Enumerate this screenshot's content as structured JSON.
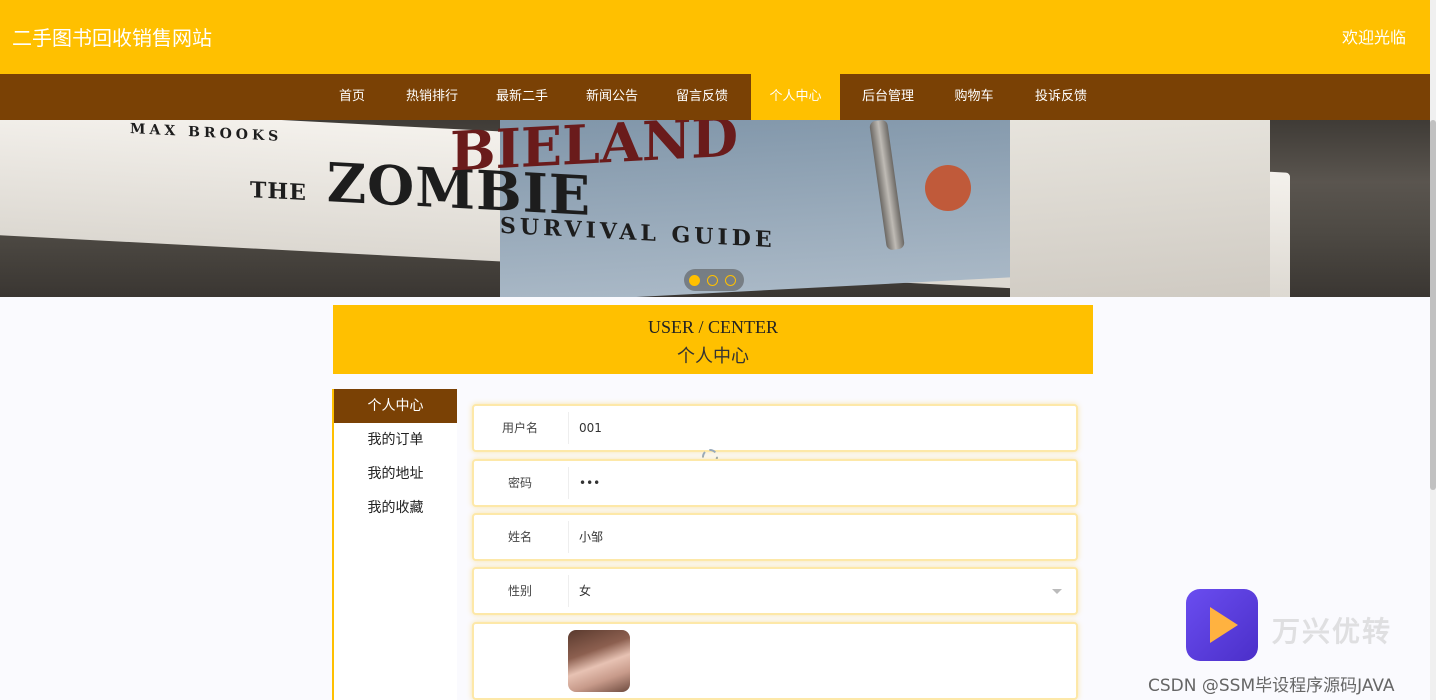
{
  "header": {
    "site_title": "二手图书回收销售网站",
    "welcome": "欢迎光临"
  },
  "nav": {
    "items": [
      {
        "label": "首页"
      },
      {
        "label": "热销排行"
      },
      {
        "label": "最新二手"
      },
      {
        "label": "新闻公告"
      },
      {
        "label": "留言反馈"
      },
      {
        "label": "个人中心",
        "active": true
      },
      {
        "label": "后台管理"
      },
      {
        "label": "购物车"
      },
      {
        "label": "投诉反馈"
      }
    ]
  },
  "banner": {
    "book_texts": {
      "author": "MAX BROOKS",
      "title": "ZOMBIE",
      "subtitle": "SURVIVAL GUIDE",
      "top_title": "BIELAND",
      "the": "THE"
    },
    "carousel_dots": 3,
    "active_dot": 0
  },
  "section": {
    "title_en": "USER / CENTER",
    "title_cn": "个人中心"
  },
  "sidebar": {
    "items": [
      {
        "label": "个人中心",
        "active": true
      },
      {
        "label": "我的订单"
      },
      {
        "label": "我的地址"
      },
      {
        "label": "我的收藏"
      }
    ]
  },
  "form": {
    "username": {
      "label": "用户名",
      "value": "001"
    },
    "password": {
      "label": "密码",
      "value": "•••"
    },
    "name": {
      "label": "姓名",
      "value": "小邹"
    },
    "gender": {
      "label": "性别",
      "value": "女"
    }
  },
  "watermark": {
    "app_text": "万兴优转",
    "csdn_text": "CSDN @SSM毕设程序源码JAVA"
  },
  "colors": {
    "accent": "#ffc000",
    "nav_bg": "#7a4105"
  }
}
